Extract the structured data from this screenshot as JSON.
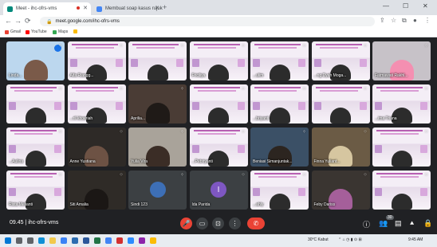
{
  "browser": {
    "tabs": [
      {
        "label": "Meet - ihc-ofrs-vms",
        "favicon": "meet-icon",
        "color": "#00897b"
      },
      {
        "label": "Membuat soap kasus rujukan ib...",
        "favicon": "doc-icon",
        "color": "#4285f4"
      }
    ],
    "new_tab": "+",
    "window_controls": [
      "—",
      "☐",
      "✕"
    ],
    "url": "meet.google.com/ihc-ofrs-vms",
    "bookmarks": [
      {
        "label": "Gmail",
        "color": "#ea4335"
      },
      {
        "label": "YouTube",
        "color": "#ff0000"
      },
      {
        "label": "Maps",
        "color": "#34a853"
      }
    ]
  },
  "meet": {
    "participants": [
      {
        "name": "Linda...",
        "type": "camera",
        "bg": "#bcd7ee",
        "skin": "#7a5a49"
      },
      {
        "name": "Alfa Riangg...",
        "type": "slide"
      },
      {
        "name": "",
        "type": "slide"
      },
      {
        "name": "Friciliya",
        "type": "slide"
      },
      {
        "name": "...ulim",
        "type": "slide"
      },
      {
        "name": "...ng Dyah Moga...",
        "type": "slide"
      },
      {
        "name": "Fatmawati Rakhl...",
        "type": "camera",
        "bg": "#c7c2c8",
        "skin": "#f48fb1"
      },
      {
        "name": "",
        "type": "slide"
      },
      {
        "name": "...ril khoeriah",
        "type": "slide"
      },
      {
        "name": "Aprilia...",
        "type": "camera",
        "bg": "#4a3c35",
        "skin": "#1f1a17"
      },
      {
        "name": "",
        "type": "slide"
      },
      {
        "name": "...briyanti",
        "type": "slide"
      },
      {
        "name": "",
        "type": "slide"
      },
      {
        "name": "...ima Triana",
        "type": "slide"
      },
      {
        "name": "...Aulina",
        "type": "slide"
      },
      {
        "name": "Anne Yustiana",
        "type": "camera",
        "bg": "#2e2a27",
        "skin": "#6d5244"
      },
      {
        "name": "Yulia Vira",
        "type": "camera",
        "bg": "#a9a39a",
        "skin": "#3b2d26"
      },
      {
        "name": "...Pebriyanti",
        "type": "slide"
      },
      {
        "name": "Beniasi Simanjuntak...",
        "type": "camera",
        "bg": "#3b5066",
        "skin": "#2c2520"
      },
      {
        "name": "Finna Yuliant...",
        "type": "camera",
        "bg": "#6b5b45",
        "skin": "#d6c6a0"
      },
      {
        "name": "",
        "type": "slide"
      },
      {
        "name": "Rista Melianti",
        "type": "slide"
      },
      {
        "name": "Siti Amalia",
        "type": "camera",
        "bg": "#2f2b27",
        "skin": "#1b1715"
      },
      {
        "name": "Sindi 123",
        "type": "avatar",
        "avatar": "",
        "color": "#3d6fb6"
      },
      {
        "name": "Ida Parida",
        "type": "avatar",
        "avatar": "I",
        "color": "#7e57c2"
      },
      {
        "name": "...ahly",
        "type": "slide"
      },
      {
        "name": "Feby Dariss",
        "type": "camera",
        "bg": "#3a3531",
        "skin": "#a55f9a"
      },
      {
        "name": "",
        "type": "slide"
      }
    ],
    "time": "09.45",
    "meeting_code": "ihc-ofrs-vms",
    "controls": [
      {
        "name": "mic-off-button",
        "icon": "🎤",
        "color": "#ea4335"
      },
      {
        "name": "camera-button",
        "icon": "▭",
        "color": "#3c4043"
      },
      {
        "name": "present-button",
        "icon": "⊡",
        "color": "#3c4043"
      },
      {
        "name": "more-options-button",
        "icon": "⋮",
        "color": "#3c4043"
      },
      {
        "name": "leave-call-button",
        "icon": "✆",
        "color": "#ea4335"
      }
    ],
    "right_controls": [
      {
        "name": "info-button",
        "icon": "ⓘ"
      },
      {
        "name": "people-button",
        "icon": "👥"
      },
      {
        "name": "chat-button",
        "icon": "▤"
      },
      {
        "name": "activities-button",
        "icon": "⯅"
      },
      {
        "name": "host-controls-button",
        "icon": "🔒"
      }
    ],
    "people_count": "30"
  },
  "taskbar": {
    "weather": "30°C  Kabut",
    "clock": "9:45 AM",
    "icons": [
      {
        "name": "start-icon",
        "color": "#0078d4"
      },
      {
        "name": "search-icon",
        "color": "#5f6368"
      },
      {
        "name": "task-view-icon",
        "color": "#5f6368"
      },
      {
        "name": "edge-icon",
        "color": "#0f8fd6"
      },
      {
        "name": "explorer-icon",
        "color": "#f2c94c"
      },
      {
        "name": "store-icon",
        "color": "#3b82f6"
      },
      {
        "name": "mail-icon",
        "color": "#2b6cb0"
      },
      {
        "name": "word-icon",
        "color": "#2b579a"
      },
      {
        "name": "excel-icon",
        "color": "#217346"
      },
      {
        "name": "chrome-icon",
        "color": "#4285f4"
      },
      {
        "name": "app-icon",
        "color": "#d32f2f"
      },
      {
        "name": "zoom-icon",
        "color": "#2d8cff"
      },
      {
        "name": "app2-icon",
        "color": "#8e24aa"
      },
      {
        "name": "chrome2-icon",
        "color": "#fbbc05"
      }
    ]
  }
}
